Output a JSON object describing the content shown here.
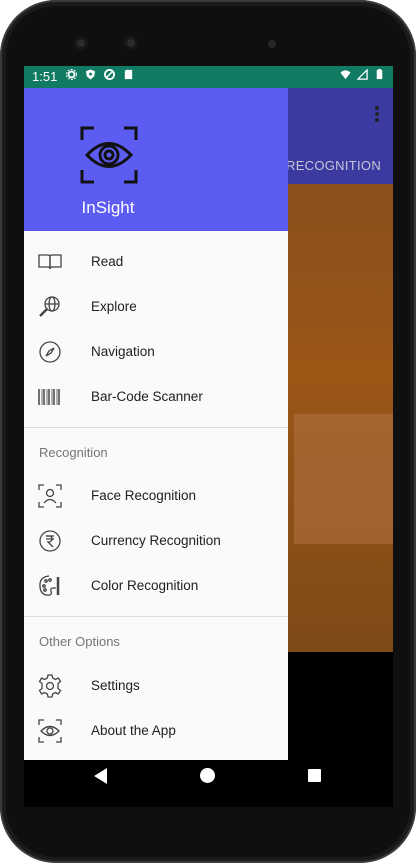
{
  "status_bar": {
    "time": "1:51"
  },
  "app_behind": {
    "tab_label": "RECOGNITION"
  },
  "drawer": {
    "title": "InSight",
    "primary_items": [
      {
        "label": "Read",
        "icon": "book-icon"
      },
      {
        "label": "Explore",
        "icon": "globe-search-icon"
      },
      {
        "label": "Navigation",
        "icon": "compass-icon"
      },
      {
        "label": "Bar-Code Scanner",
        "icon": "barcode-icon"
      }
    ],
    "recognition_section": {
      "title": "Recognition",
      "items": [
        {
          "label": "Face Recognition",
          "icon": "face-scan-icon"
        },
        {
          "label": "Currency Recognition",
          "icon": "rupee-icon"
        },
        {
          "label": "Color Recognition",
          "icon": "palette-icon"
        }
      ]
    },
    "other_section": {
      "title": "Other Options",
      "items": [
        {
          "label": "Settings",
          "icon": "gear-icon"
        },
        {
          "label": "About the App",
          "icon": "eye-scan-icon"
        }
      ]
    }
  },
  "colors": {
    "header": "#5c5cf3",
    "status_bar": "#117a62",
    "drawer_bg": "#fafafa"
  }
}
